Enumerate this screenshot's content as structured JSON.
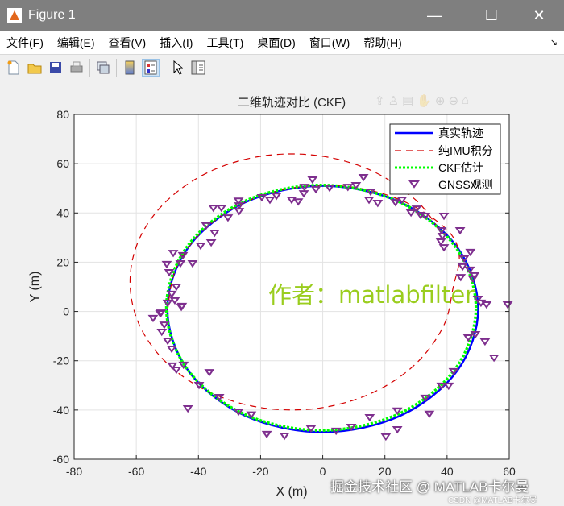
{
  "window": {
    "title": "Figure 1",
    "minimize": "—",
    "maximize": "☐",
    "close": "✕"
  },
  "menu": [
    "文件(F)",
    "编辑(E)",
    "查看(V)",
    "插入(I)",
    "工具(T)",
    "桌面(D)",
    "窗口(W)",
    "帮助(H)"
  ],
  "menu_dock": "↘",
  "toolbar": [
    "new-figure",
    "open-file",
    "save",
    "print",
    "link-plot",
    "insert-colorbar",
    "insert-legend",
    "edit-plot",
    "property-inspector"
  ],
  "watermarks": {
    "author": "作者：matlabfilter",
    "juejin": "掘金技术社区 @ MATLAB卡尔曼",
    "csdn": "CSDN @MATLAB卡尔曼"
  },
  "chart_data": {
    "type": "line",
    "title": "二维轨迹对比 (CKF)",
    "xlabel": "X (m)",
    "ylabel": "Y (m)",
    "xlim": [
      -80,
      60
    ],
    "ylim": [
      -60,
      80
    ],
    "xticks": [
      -80,
      -60,
      -40,
      -20,
      0,
      20,
      40,
      60
    ],
    "yticks": [
      -60,
      -40,
      -20,
      0,
      20,
      40,
      60,
      80
    ],
    "grid": true,
    "legend_position": "top-right",
    "series": [
      {
        "name": "真实轨迹",
        "style": "solid",
        "color": "#0000ff",
        "closed": true,
        "points": [
          [
            50,
            1
          ],
          [
            43.3,
            26
          ],
          [
            25,
            44.3
          ],
          [
            0,
            51
          ],
          [
            -25,
            44.3
          ],
          [
            -43.3,
            26
          ],
          [
            -50,
            1
          ],
          [
            -43.3,
            -24
          ],
          [
            -25,
            -42.3
          ],
          [
            0,
            -49
          ],
          [
            25,
            -42.3
          ],
          [
            43.3,
            -24
          ]
        ]
      },
      {
        "name": "纯IMU积分",
        "style": "dashed",
        "color": "#d40000",
        "closed": false,
        "points": [
          [
            -50,
            0
          ],
          [
            -47.3,
            17.2
          ],
          [
            -38.8,
            32.5
          ],
          [
            -25.4,
            44.1
          ],
          [
            -8.9,
            50.3
          ],
          [
            8.9,
            50.6
          ],
          [
            25.9,
            44.8
          ],
          [
            39.8,
            33.4
          ],
          [
            43.9,
            22.8
          ],
          [
            42,
            10
          ],
          [
            38.9,
            -5.8
          ],
          [
            29.8,
            -21.4
          ],
          [
            16,
            -33
          ],
          [
            -1,
            -39.2
          ],
          [
            -19,
            -39.2
          ],
          [
            -36,
            -33
          ],
          [
            -49.8,
            -21.4
          ],
          [
            -58.9,
            -5.8
          ],
          [
            -62,
            12
          ],
          [
            -58.9,
            29.8
          ],
          [
            -49.8,
            45.4
          ],
          [
            -36,
            57
          ],
          [
            -19,
            63.2
          ],
          [
            -1,
            63.2
          ],
          [
            16,
            57
          ],
          [
            29.8,
            45.4
          ],
          [
            37.1,
            34
          ]
        ]
      },
      {
        "name": "CKF估计",
        "style": "dotted",
        "color": "#00ff00",
        "closed": true,
        "points": [
          [
            49.3,
            1.5
          ],
          [
            42.6,
            26.4
          ],
          [
            24.4,
            44.6
          ],
          [
            -0.5,
            51.3
          ],
          [
            -25.4,
            44.6
          ],
          [
            -43.6,
            26.4
          ],
          [
            -50.3,
            1.5
          ],
          [
            -43.6,
            -23.4
          ],
          [
            -25.4,
            -41.6
          ],
          [
            -0.5,
            -48.3
          ],
          [
            24.4,
            -41.6
          ],
          [
            42.6,
            -23.4
          ]
        ]
      },
      {
        "name": "GNSS观测",
        "style": "marker-triangle-down",
        "color": "#7e2f8e",
        "points": [
          [
            -3.3,
            53.5
          ],
          [
            -5.9,
            50.5
          ],
          [
            -2.2,
            49.6
          ],
          [
            -6.1,
            47.9
          ],
          [
            -10,
            45.3
          ],
          [
            -7.9,
            44.6
          ],
          [
            -19.6,
            46.3
          ],
          [
            -17,
            45.3
          ],
          [
            -14.9,
            46.9
          ],
          [
            -27.1,
            44.9
          ],
          [
            -26.9,
            43
          ],
          [
            -26.9,
            40.7
          ],
          [
            -35.2,
            42
          ],
          [
            -32.6,
            42
          ],
          [
            -30.5,
            38.1
          ],
          [
            -37.5,
            34.9
          ],
          [
            -34.8,
            31.9
          ],
          [
            -35.9,
            28
          ],
          [
            -39.3,
            26.7
          ],
          [
            -45,
            22.8
          ],
          [
            -48.1,
            23.7
          ],
          [
            -45.8,
            19.5
          ],
          [
            -50.2,
            19.2
          ],
          [
            -41.9,
            19.5
          ],
          [
            -49.4,
            15.9
          ],
          [
            -47.1,
            10
          ],
          [
            -48.6,
            7.1
          ],
          [
            -47.6,
            4.5
          ],
          [
            -49.9,
            3.5
          ],
          [
            -45.3,
            2.2
          ],
          [
            -52,
            -0.5
          ],
          [
            13.1,
            54.5
          ],
          [
            2.2,
            50.2
          ],
          [
            8.1,
            50.5
          ],
          [
            10.7,
            51.2
          ],
          [
            15.4,
            48.6
          ],
          [
            14.9,
            45.3
          ],
          [
            17.7,
            44
          ],
          [
            23.4,
            44.3
          ],
          [
            25.5,
            45.3
          ],
          [
            29.4,
            51.6
          ],
          [
            28.4,
            40.1
          ],
          [
            30.2,
            41.7
          ],
          [
            31.5,
            39.1
          ],
          [
            33,
            38.8
          ],
          [
            39,
            38.8
          ],
          [
            44.2,
            32.9
          ],
          [
            38.2,
            32.9
          ],
          [
            38.5,
            30.6
          ],
          [
            38,
            28.3
          ],
          [
            39,
            26
          ],
          [
            47.5,
            24.1
          ],
          [
            45.5,
            21.5
          ],
          [
            45,
            18.2
          ],
          [
            47.3,
            16.9
          ],
          [
            44.4,
            13.9
          ],
          [
            48.3,
            13.3
          ],
          [
            48.8,
            14.6
          ],
          [
            49.9,
            5.1
          ],
          [
            50.9,
            3.5
          ],
          [
            52.7,
            2.8
          ],
          [
            59.5,
            2.8
          ],
          [
            -45.5,
            1.8
          ],
          [
            -54.6,
            -2.7
          ],
          [
            -52.3,
            -0.8
          ],
          [
            -51,
            -5.4
          ],
          [
            -51.8,
            -8.3
          ],
          [
            -49.9,
            -11.9
          ],
          [
            -48.6,
            -15.2
          ],
          [
            -48.4,
            -22
          ],
          [
            -47.1,
            -23.7
          ],
          [
            -44.8,
            -21.7
          ],
          [
            -36.5,
            -24.7
          ],
          [
            -39.8,
            -29.9
          ],
          [
            -33.3,
            -34.8
          ],
          [
            -43.4,
            -39.4
          ],
          [
            -27.1,
            -40.7
          ],
          [
            -23,
            -41.9
          ],
          [
            -18,
            -49.8
          ],
          [
            -12.3,
            -50.5
          ],
          [
            -3.8,
            -47.5
          ],
          [
            4.3,
            -48.5
          ],
          [
            9.2,
            -46.9
          ],
          [
            15.1,
            -43
          ],
          [
            20.3,
            -50.8
          ],
          [
            24,
            -40.3
          ],
          [
            24,
            -47.9
          ],
          [
            34.3,
            -41.6
          ],
          [
            33,
            -35.1
          ],
          [
            38.2,
            -30.2
          ],
          [
            40.5,
            -30.2
          ],
          [
            42.1,
            -24.3
          ],
          [
            46.8,
            -10.6
          ],
          [
            49.1,
            -9.3
          ],
          [
            52.2,
            -12.2
          ],
          [
            55.1,
            -18.8
          ]
        ]
      }
    ]
  }
}
